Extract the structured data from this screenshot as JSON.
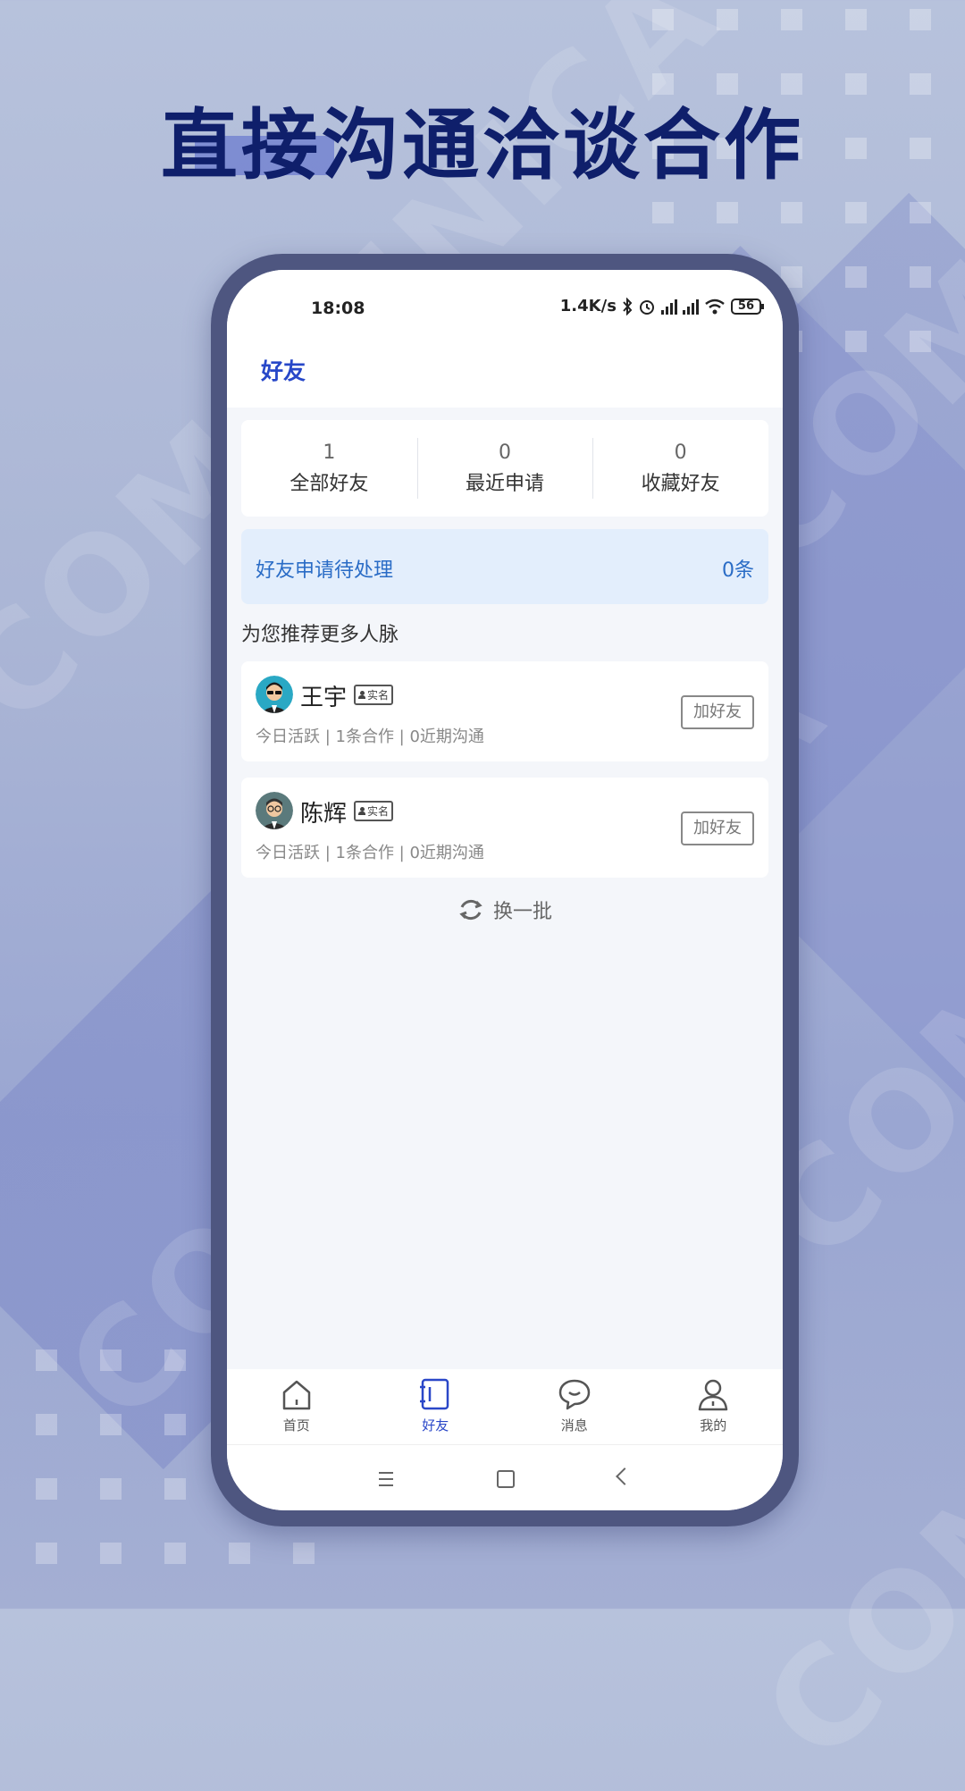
{
  "headline": "直接沟通洽谈合作",
  "watermark": "COMMUNICA",
  "status_bar": {
    "time": "18:08",
    "speed": "1.4K/s",
    "battery": "56"
  },
  "app_title": "好友",
  "stats": [
    {
      "value": "1",
      "label": "全部好友"
    },
    {
      "value": "0",
      "label": "最近申请"
    },
    {
      "value": "0",
      "label": "收藏好友"
    }
  ],
  "pending": {
    "label": "好友申请待处理",
    "count": "0条"
  },
  "recommend_title": "为您推荐更多人脉",
  "people": [
    {
      "name": "王宇",
      "badge": "实名",
      "meta": "今日活跃 | 1条合作 | 0近期沟通",
      "action": "加好友"
    },
    {
      "name": "陈辉",
      "badge": "实名",
      "meta": "今日活跃 | 1条合作 | 0近期沟通",
      "action": "加好友"
    }
  ],
  "refresh_label": "换一批",
  "tabs": [
    {
      "label": "首页",
      "icon": "home-icon"
    },
    {
      "label": "好友",
      "icon": "contacts-icon"
    },
    {
      "label": "消息",
      "icon": "chat-icon"
    },
    {
      "label": "我的",
      "icon": "profile-icon"
    }
  ],
  "colors": {
    "accent": "#2a47c8",
    "pending_bg": "#e3eefc",
    "pending_text": "#2a6cc6",
    "headline": "#0f1f6b"
  }
}
